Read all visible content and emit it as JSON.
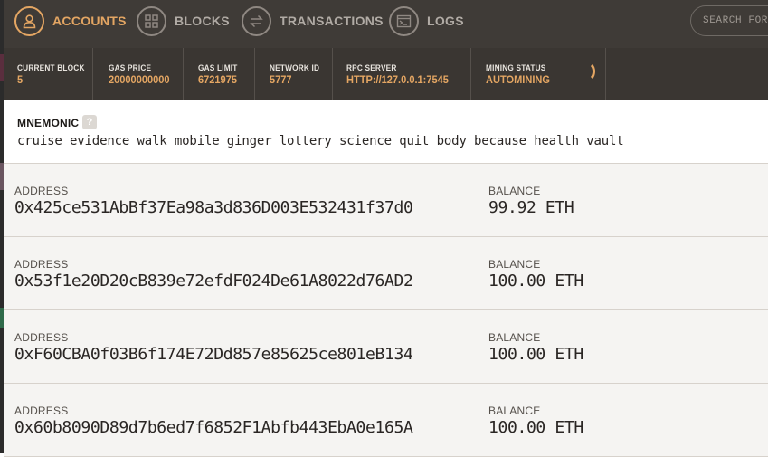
{
  "nav": {
    "items": [
      {
        "label": "ACCOUNTS",
        "icon": "user-icon",
        "active": true
      },
      {
        "label": "BLOCKS",
        "icon": "grid-icon",
        "active": false
      },
      {
        "label": "TRANSACTIONS",
        "icon": "swap-icon",
        "active": false
      },
      {
        "label": "LOGS",
        "icon": "terminal-icon",
        "active": false
      }
    ],
    "search_placeholder": "SEARCH FOR BLOCK NUMBERS OR TX HASHES"
  },
  "status": {
    "current_block": {
      "label": "CURRENT BLOCK",
      "value": "5"
    },
    "gas_price": {
      "label": "GAS PRICE",
      "value": "20000000000"
    },
    "gas_limit": {
      "label": "GAS LIMIT",
      "value": "6721975"
    },
    "network_id": {
      "label": "NETWORK ID",
      "value": "5777"
    },
    "rpc_server": {
      "label": "RPC SERVER",
      "value": "HTTP://127.0.0.1:7545"
    },
    "mining_status": {
      "label": "MINING STATUS",
      "value": "AUTOMINING"
    }
  },
  "mnemonic": {
    "title": "MNEMONIC",
    "help": "?",
    "words": "cruise evidence walk mobile ginger lottery science quit body because health vault"
  },
  "accounts": {
    "address_label": "ADDRESS",
    "balance_label": "BALANCE",
    "rows": [
      {
        "address": "0x425ce531AbBf37Ea98a3d836D003E532431f37d0",
        "balance": "99.92 ETH"
      },
      {
        "address": "0x53f1e20D20cB839e72efdF024De61A8022d76AD2",
        "balance": "100.00 ETH"
      },
      {
        "address": "0xF60CBA0f03B6f174E72Dd857e85625ce801eB134",
        "balance": "100.00 ETH"
      },
      {
        "address": "0x60b8090D89d7b6ed7f6852F1Abfb443EbA0e165A",
        "balance": "100.00 ETH"
      }
    ]
  },
  "colors": {
    "accent": "#e4a663",
    "nav_bg": "#3f3b37",
    "status_bg": "#3a3632"
  }
}
